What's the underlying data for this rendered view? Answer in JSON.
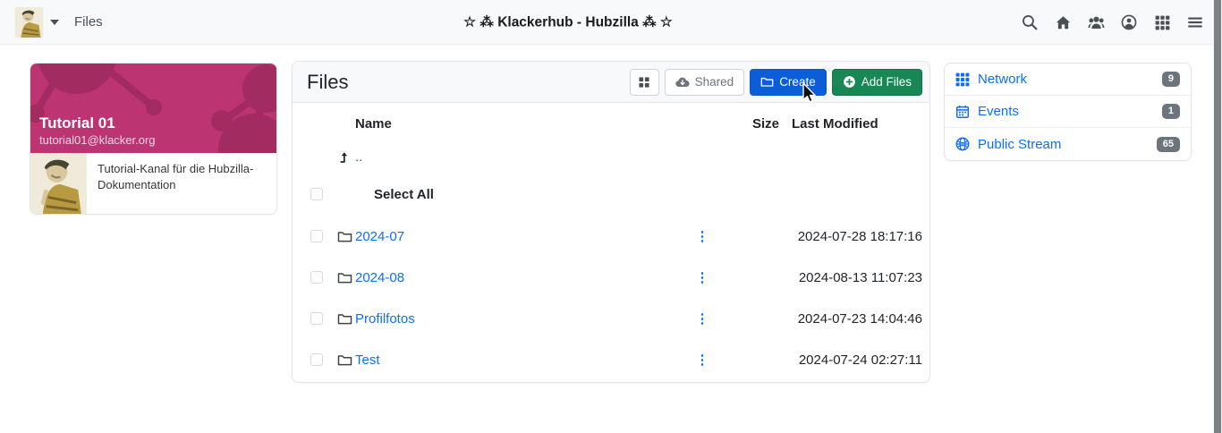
{
  "colors": {
    "accent_blue": "#0d6efd",
    "create_button_blue": "#0b5ed7",
    "add_files_green": "#198754",
    "banner_magenta": "#bd3473",
    "banner_pattern": "#a22c61",
    "badge_gray": "#6c757d",
    "navbar_bg": "#f8f9fa"
  },
  "navbar": {
    "app_link": "Files",
    "title": "☆ ⁂ Klackerhub - Hubzilla ⁂ ☆",
    "icons": [
      "search",
      "home",
      "group",
      "account",
      "apps-grid",
      "menu"
    ]
  },
  "channel_card": {
    "name": "Tutorial 01",
    "address": "tutorial01@klacker.org",
    "description": "Tutorial-Kanal für die Hubzilla-Dokumentation"
  },
  "files": {
    "title": "Files",
    "shared_button": "Shared",
    "create_button": "Create",
    "add_files_button": "Add Files",
    "columns": {
      "name": "Name",
      "size": "Size",
      "modified": "Last Modified"
    },
    "parent_dir": "..",
    "select_all": "Select All",
    "rows": [
      {
        "name": "2024-07",
        "size": "",
        "modified": "2024-07-28 18:17:16"
      },
      {
        "name": "2024-08",
        "size": "",
        "modified": "2024-08-13 11:07:23"
      },
      {
        "name": "Profilfotos",
        "size": "",
        "modified": "2024-07-23 14:04:46"
      },
      {
        "name": "Test",
        "size": "",
        "modified": "2024-07-24 02:27:11"
      }
    ]
  },
  "widgets": {
    "items": [
      {
        "label": "Network",
        "count": "9"
      },
      {
        "label": "Events",
        "count": "1"
      },
      {
        "label": "Public Stream",
        "count": "65"
      }
    ]
  }
}
